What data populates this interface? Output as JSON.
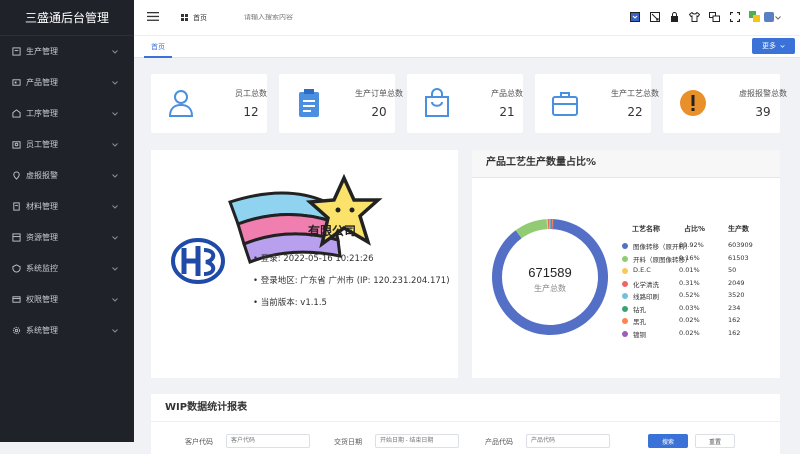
{
  "app": {
    "title": "三盛通后台管理"
  },
  "sidebar": {
    "items": [
      {
        "label": "生产管理",
        "icon": "production-icon"
      },
      {
        "label": "产品管理",
        "icon": "product-icon"
      },
      {
        "label": "工序管理",
        "icon": "process-icon"
      },
      {
        "label": "员工管理",
        "icon": "staff-icon"
      },
      {
        "label": "虚报报警",
        "icon": "alarm-icon"
      },
      {
        "label": "材料管理",
        "icon": "material-icon"
      },
      {
        "label": "资源管理",
        "icon": "resource-icon"
      },
      {
        "label": "系统监控",
        "icon": "monitor-icon"
      },
      {
        "label": "权限管理",
        "icon": "permission-icon"
      },
      {
        "label": "系统管理",
        "icon": "settings-icon"
      }
    ]
  },
  "header": {
    "breadcrumb": "首页",
    "search_placeholder": "请输入搜索内容"
  },
  "tabs": {
    "home": "首页",
    "more": "更多"
  },
  "stats": [
    {
      "label": "员工总数",
      "value": "12",
      "color": "#4b8fe0"
    },
    {
      "label": "生产订单总数",
      "value": "20",
      "color": "#4b8fe0"
    },
    {
      "label": "产品总数",
      "value": "21",
      "color": "#4b8fe0"
    },
    {
      "label": "生产工艺总数",
      "value": "22",
      "color": "#4b8fe0"
    },
    {
      "label": "虚报报警总数",
      "value": "39",
      "color": "#e8902a"
    }
  ],
  "info": {
    "company": "有限公司",
    "last_login": "登录: 2022-05-16 10:21:26",
    "login_area": "登录地区: 广东省 广州市 (IP: 120.231.204.171)",
    "version": "当前版本: v1.1.5"
  },
  "chart_data": {
    "type": "pie",
    "title": "产品工艺生产数量占比%",
    "total": 671589,
    "total_label": "生产总数",
    "legend_headers": [
      "工艺名称",
      "占比%",
      "生产数"
    ],
    "series": [
      {
        "name": "图像转移（原开料）",
        "pct": "89.92%",
        "value": 603909,
        "color": "#5470c6"
      },
      {
        "name": "开料（原图像转移）",
        "pct": "9.16%",
        "value": 61503,
        "color": "#91cc75"
      },
      {
        "name": "D.E.C",
        "pct": "0.01%",
        "value": 50,
        "color": "#fac858"
      },
      {
        "name": "化学清洗",
        "pct": "0.31%",
        "value": 2049,
        "color": "#ee6666"
      },
      {
        "name": "线路印刷",
        "pct": "0.52%",
        "value": 3520,
        "color": "#73c0de"
      },
      {
        "name": "钻孔",
        "pct": "0.03%",
        "value": 234,
        "color": "#3ba272"
      },
      {
        "name": "黑孔",
        "pct": "0.02%",
        "value": 162,
        "color": "#fc8452"
      },
      {
        "name": "镀铜",
        "pct": "0.02%",
        "value": 162,
        "color": "#9a60b4"
      }
    ]
  },
  "wip": {
    "title": "WIP数据统计报表",
    "fields": [
      {
        "label": "客户代码",
        "placeholder": "客户代码"
      },
      {
        "label": "交货日期",
        "placeholder": "开始日期 - 结束日期"
      },
      {
        "label": "产品代码",
        "placeholder": "产品代码"
      }
    ],
    "search_btn": "搜索",
    "reset_btn": "重置"
  },
  "colors": {
    "accent": "#3a72d8",
    "sidebar_bg": "#20222a"
  }
}
